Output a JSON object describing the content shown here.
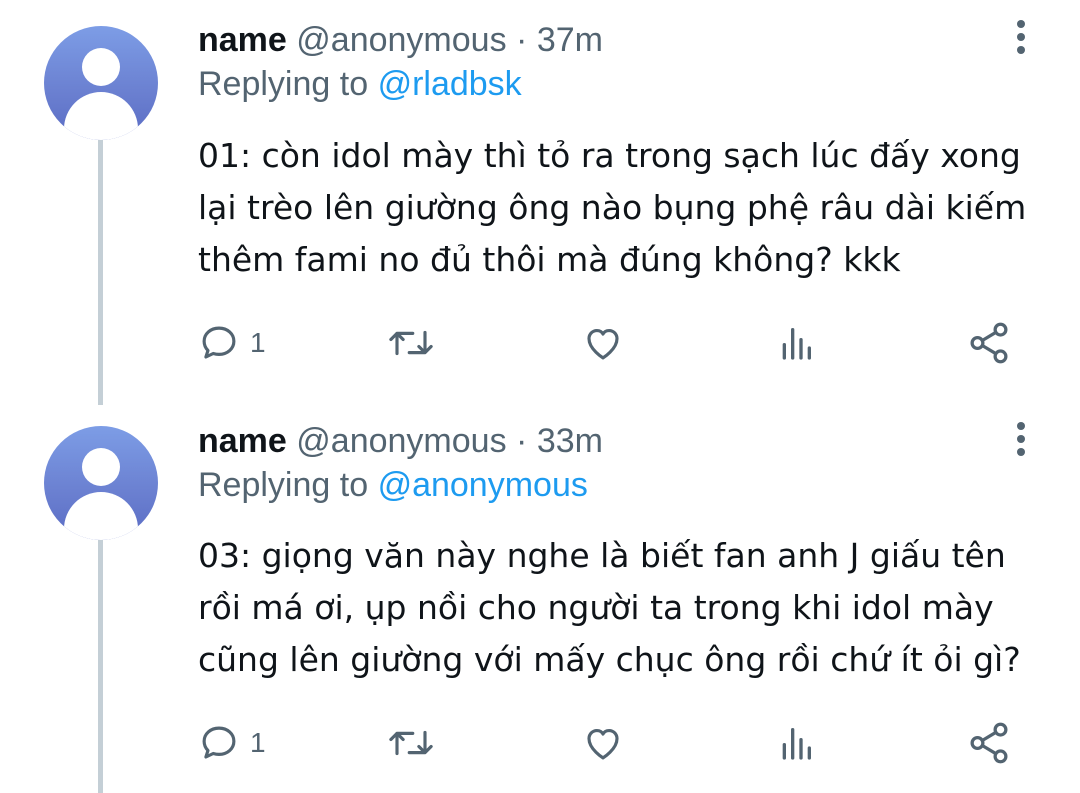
{
  "tweets": [
    {
      "display_name": "name",
      "handle": "@anonymous",
      "separator": "·",
      "time": "37m",
      "replying_prefix": "Replying to",
      "replying_to": "@rladbsk",
      "text": "01: còn idol mày thì tỏ ra trong sạch lúc đấy xong\nlại trèo lên giường ông nào bụng phệ râu dài kiếm\nthêm fami no đủ thôi mà đúng không? kkk",
      "reply_count": "1",
      "icons": {
        "reply": "comment-icon",
        "retweet": "retweet-icon",
        "like": "heart-icon",
        "stats": "bar-chart-icon",
        "share": "share-icon",
        "more": "more-vertical-icon"
      }
    },
    {
      "display_name": "name",
      "handle": "@anonymous",
      "separator": "·",
      "time": "33m",
      "replying_prefix": "Replying to",
      "replying_to": "@anonymous",
      "text": "03: giọng văn này nghe là biết fan anh J giấu tên\nrồi má ơi, ụp nồi cho người ta trong khi idol mày\ncũng lên giường với mấy chục ông rồi chứ ít ỏi gì?",
      "reply_count": "1",
      "icons": {
        "reply": "comment-icon",
        "retweet": "retweet-icon",
        "like": "heart-icon",
        "stats": "bar-chart-icon",
        "share": "share-icon",
        "more": "more-vertical-icon"
      }
    }
  ],
  "colors": {
    "text_primary": "#0f1419",
    "text_secondary": "#536471",
    "mention": "#1d9bf0",
    "thread_line": "#c4cfd6",
    "avatar": "#6a7fd0"
  }
}
